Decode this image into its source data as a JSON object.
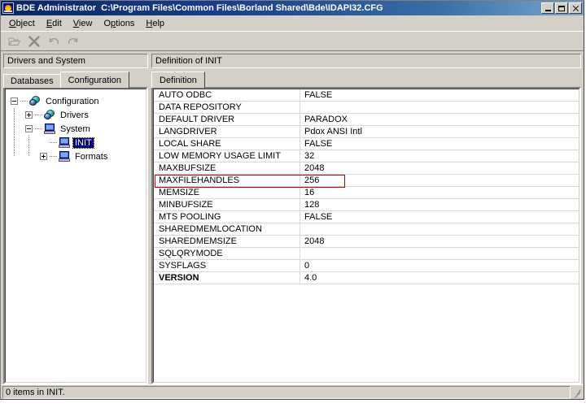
{
  "window": {
    "app_title": "BDE Administrator",
    "document_path": "C:\\Program Files\\Common Files\\Borland Shared\\Bde\\IDAPI32.CFG",
    "icon": "bde-app-icon",
    "buttons": {
      "minimize": "minimize-button",
      "maximize": "maximize-button",
      "close": "close-button"
    }
  },
  "menubar": {
    "items": [
      {
        "label": "Object",
        "accel": "O"
      },
      {
        "label": "Edit",
        "accel": "E"
      },
      {
        "label": "View",
        "accel": "V"
      },
      {
        "label": "Options",
        "accel": "O"
      },
      {
        "label": "Help",
        "accel": "H"
      }
    ]
  },
  "toolbar": {
    "buttons": [
      {
        "name": "open-icon",
        "title": "Open"
      },
      {
        "name": "delete-x-icon",
        "title": "Delete"
      },
      {
        "name": "undo-icon",
        "title": "Undo"
      },
      {
        "name": "redo-icon",
        "title": "Redo"
      }
    ]
  },
  "left_pane": {
    "header": "Drivers and System",
    "tabs": [
      {
        "label": "Databases",
        "active": false
      },
      {
        "label": "Configuration",
        "active": true
      }
    ],
    "tree": {
      "root": {
        "label": "Configuration",
        "icon": "globe-icon",
        "expander": "minus",
        "children": [
          {
            "label": "Drivers",
            "icon": "globe-icon",
            "expander": "plus",
            "children": []
          },
          {
            "label": "System",
            "icon": "computer-icon",
            "expander": "minus",
            "children": [
              {
                "label": "INIT",
                "icon": "computer-icon",
                "expander": "none",
                "selected": true
              },
              {
                "label": "Formats",
                "icon": "computer-icon",
                "expander": "plus",
                "selected": false
              }
            ]
          }
        ]
      }
    }
  },
  "right_pane": {
    "header": "Definition of INIT",
    "tabs": [
      {
        "label": "Definition",
        "active": true
      }
    ],
    "definition_rows": [
      {
        "name": "AUTO ODBC",
        "value": "FALSE",
        "bold": false,
        "highlighted": false
      },
      {
        "name": "DATA REPOSITORY",
        "value": "",
        "bold": false,
        "highlighted": false
      },
      {
        "name": "DEFAULT DRIVER",
        "value": "PARADOX",
        "bold": false,
        "highlighted": false
      },
      {
        "name": "LANGDRIVER",
        "value": "Pdox ANSI Intl",
        "bold": false,
        "highlighted": false
      },
      {
        "name": "LOCAL SHARE",
        "value": "FALSE",
        "bold": false,
        "highlighted": false
      },
      {
        "name": "LOW MEMORY USAGE LIMIT",
        "value": "32",
        "bold": false,
        "highlighted": false
      },
      {
        "name": "MAXBUFSIZE",
        "value": "2048",
        "bold": false,
        "highlighted": false
      },
      {
        "name": "MAXFILEHANDLES",
        "value": "256",
        "bold": false,
        "highlighted": true
      },
      {
        "name": "MEMSIZE",
        "value": "16",
        "bold": false,
        "highlighted": false
      },
      {
        "name": "MINBUFSIZE",
        "value": "128",
        "bold": false,
        "highlighted": false
      },
      {
        "name": "MTS POOLING",
        "value": "FALSE",
        "bold": false,
        "highlighted": false
      },
      {
        "name": "SHAREDMEMLOCATION",
        "value": "",
        "bold": false,
        "highlighted": false
      },
      {
        "name": "SHAREDMEMSIZE",
        "value": "2048",
        "bold": false,
        "highlighted": false
      },
      {
        "name": "SQLQRYMODE",
        "value": "",
        "bold": false,
        "highlighted": false
      },
      {
        "name": "SYSFLAGS",
        "value": "0",
        "bold": false,
        "highlighted": false
      },
      {
        "name": "VERSION",
        "value": "4.0",
        "bold": true,
        "highlighted": false
      }
    ],
    "annotation_color": "#c00000"
  },
  "statusbar": {
    "text": "0 items in INIT."
  }
}
